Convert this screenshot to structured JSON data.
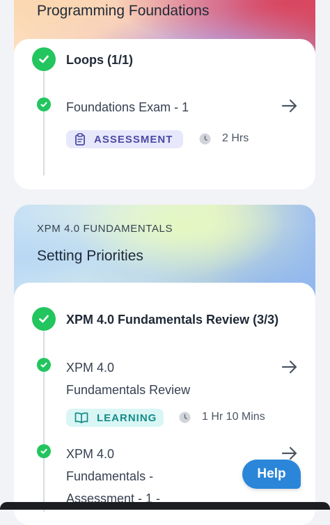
{
  "courses": [
    {
      "subtitle": "",
      "title": "Programming Foundations",
      "module": {
        "title": "Loops (1/1)",
        "items": [
          {
            "title": "Foundations Exam - 1",
            "badge": "ASSESSMENT",
            "badge_icon": "clipboard-icon",
            "duration": "2 Hrs"
          }
        ]
      }
    },
    {
      "subtitle": "XPM 4.0 FUNDAMENTALS",
      "title": "Setting Priorities",
      "module": {
        "title": "XPM 4.0 Fundamentals Review (3/3)",
        "items": [
          {
            "title_line1": "XPM 4.0",
            "title_line2": "Fundamentals Review",
            "badge": "LEARNING",
            "badge_icon": "book-icon",
            "duration": "1 Hr 10 Mins"
          },
          {
            "title_line1": "XPM 4.0",
            "title_line2": "Fundamentals -",
            "title_line3": "Assessment - 1 -"
          }
        ]
      }
    }
  ],
  "help": {
    "label": "Help"
  },
  "colors": {
    "check": "#22c55e",
    "assessment_badge_bg": "#e7e8fb",
    "assessment_badge_text": "#4b4aa3",
    "learning_badge_bg": "#d9f6f5",
    "learning_badge_text": "#148b88",
    "help_button": "#2b86d9"
  }
}
